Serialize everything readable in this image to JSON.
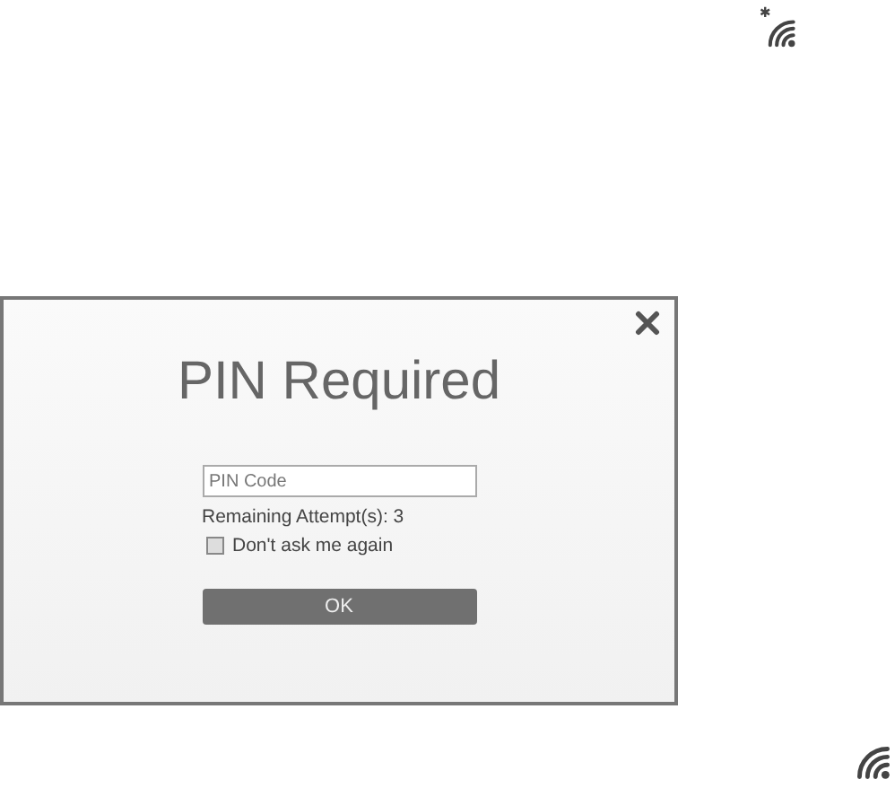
{
  "dialog": {
    "title": "PIN Required",
    "pin_field": {
      "placeholder": "PIN Code"
    },
    "remaining_attempts": "Remaining Attempt(s): 3",
    "dont_ask": {
      "label": "Don't ask me again",
      "checked": false
    },
    "ok_button": "OK"
  }
}
